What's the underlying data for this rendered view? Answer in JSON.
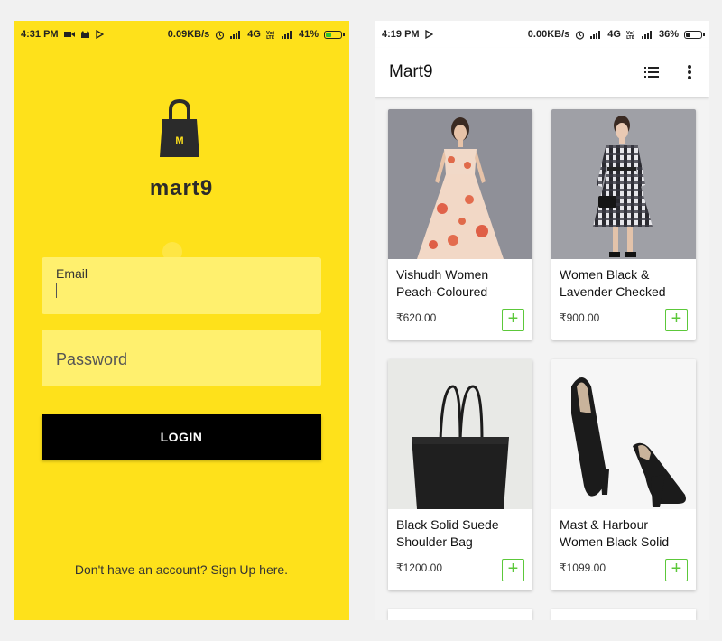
{
  "login_screen": {
    "statusbar": {
      "time": "4:31 PM",
      "left_icons": [
        "video-icon",
        "cat-icon",
        "play-store-icon"
      ],
      "speed": "0.09KB/s",
      "network": "4G",
      "battery": "41%",
      "battery_level": 0.41,
      "charging": true
    },
    "brand": "mart9",
    "logo_letter": "M",
    "email": {
      "label": "Email",
      "value": ""
    },
    "password": {
      "placeholder": "Password",
      "value": ""
    },
    "login_label": "LOGIN",
    "signup_text": "Don't have an account? Sign Up here.",
    "colors": {
      "background": "#fee11b",
      "field": "#fff06e",
      "button": "#000000"
    }
  },
  "shop_screen": {
    "statusbar": {
      "time": "4:19 PM",
      "left_icons": [
        "play-store-icon"
      ],
      "speed": "0.00KB/s",
      "network": "4G",
      "battery": "36%",
      "battery_level": 0.36,
      "charging": false
    },
    "appbar": {
      "title": "Mart9",
      "icons": [
        "list-view-icon",
        "more-vert-icon"
      ]
    },
    "products": [
      {
        "name": "Vishudh Women Peach-Coloured",
        "price": "₹620.00",
        "image": "floral-dress-image"
      },
      {
        "name": "Women Black & Lavender Checked",
        "price": "₹900.00",
        "image": "checked-dress-image"
      },
      {
        "name": "Black Solid Suede Shoulder Bag",
        "price": "₹1200.00",
        "image": "black-bag-image"
      },
      {
        "name": "Mast & Harbour Women Black Solid",
        "price": "₹1099.00",
        "image": "black-heels-image"
      }
    ],
    "add_label": "+",
    "colors": {
      "accent": "#5cc83a",
      "background": "#f3f3f3"
    }
  }
}
